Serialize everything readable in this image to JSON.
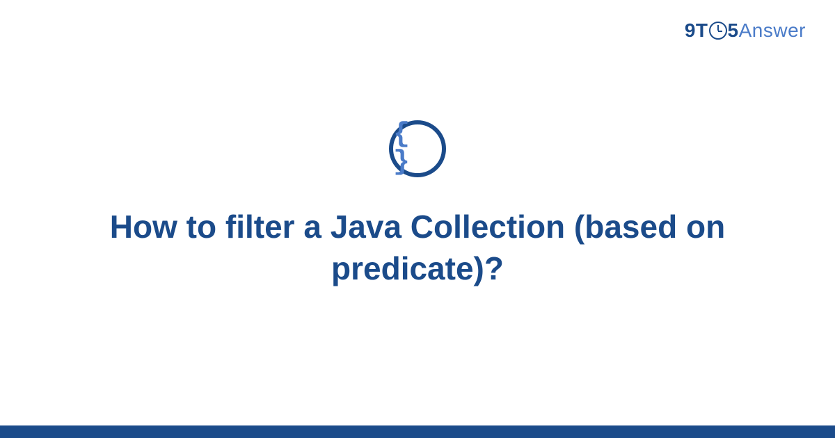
{
  "logo": {
    "prefix": "9T",
    "suffix": "5",
    "word": "Answer"
  },
  "icon": {
    "symbol": "{ }"
  },
  "title": "How to filter a Java Collection (based on predicate)?"
}
